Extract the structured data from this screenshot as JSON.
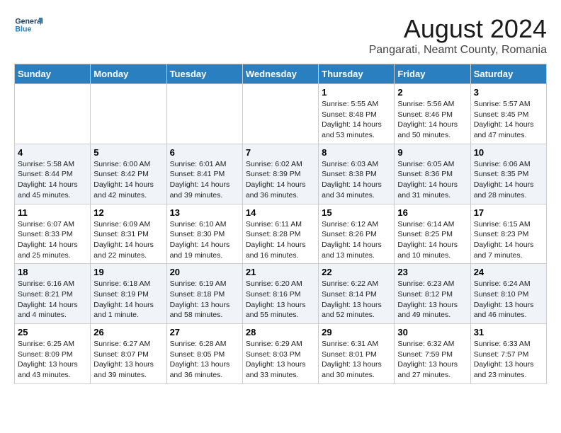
{
  "header": {
    "logo_general": "General",
    "logo_blue": "Blue",
    "month_year": "August 2024",
    "location": "Pangarati, Neamt County, Romania"
  },
  "days_of_week": [
    "Sunday",
    "Monday",
    "Tuesday",
    "Wednesday",
    "Thursday",
    "Friday",
    "Saturday"
  ],
  "weeks": [
    [
      {
        "day": "",
        "info": ""
      },
      {
        "day": "",
        "info": ""
      },
      {
        "day": "",
        "info": ""
      },
      {
        "day": "",
        "info": ""
      },
      {
        "day": "1",
        "info": "Sunrise: 5:55 AM\nSunset: 8:48 PM\nDaylight: 14 hours\nand 53 minutes."
      },
      {
        "day": "2",
        "info": "Sunrise: 5:56 AM\nSunset: 8:46 PM\nDaylight: 14 hours\nand 50 minutes."
      },
      {
        "day": "3",
        "info": "Sunrise: 5:57 AM\nSunset: 8:45 PM\nDaylight: 14 hours\nand 47 minutes."
      }
    ],
    [
      {
        "day": "4",
        "info": "Sunrise: 5:58 AM\nSunset: 8:44 PM\nDaylight: 14 hours\nand 45 minutes."
      },
      {
        "day": "5",
        "info": "Sunrise: 6:00 AM\nSunset: 8:42 PM\nDaylight: 14 hours\nand 42 minutes."
      },
      {
        "day": "6",
        "info": "Sunrise: 6:01 AM\nSunset: 8:41 PM\nDaylight: 14 hours\nand 39 minutes."
      },
      {
        "day": "7",
        "info": "Sunrise: 6:02 AM\nSunset: 8:39 PM\nDaylight: 14 hours\nand 36 minutes."
      },
      {
        "day": "8",
        "info": "Sunrise: 6:03 AM\nSunset: 8:38 PM\nDaylight: 14 hours\nand 34 minutes."
      },
      {
        "day": "9",
        "info": "Sunrise: 6:05 AM\nSunset: 8:36 PM\nDaylight: 14 hours\nand 31 minutes."
      },
      {
        "day": "10",
        "info": "Sunrise: 6:06 AM\nSunset: 8:35 PM\nDaylight: 14 hours\nand 28 minutes."
      }
    ],
    [
      {
        "day": "11",
        "info": "Sunrise: 6:07 AM\nSunset: 8:33 PM\nDaylight: 14 hours\nand 25 minutes."
      },
      {
        "day": "12",
        "info": "Sunrise: 6:09 AM\nSunset: 8:31 PM\nDaylight: 14 hours\nand 22 minutes."
      },
      {
        "day": "13",
        "info": "Sunrise: 6:10 AM\nSunset: 8:30 PM\nDaylight: 14 hours\nand 19 minutes."
      },
      {
        "day": "14",
        "info": "Sunrise: 6:11 AM\nSunset: 8:28 PM\nDaylight: 14 hours\nand 16 minutes."
      },
      {
        "day": "15",
        "info": "Sunrise: 6:12 AM\nSunset: 8:26 PM\nDaylight: 14 hours\nand 13 minutes."
      },
      {
        "day": "16",
        "info": "Sunrise: 6:14 AM\nSunset: 8:25 PM\nDaylight: 14 hours\nand 10 minutes."
      },
      {
        "day": "17",
        "info": "Sunrise: 6:15 AM\nSunset: 8:23 PM\nDaylight: 14 hours\nand 7 minutes."
      }
    ],
    [
      {
        "day": "18",
        "info": "Sunrise: 6:16 AM\nSunset: 8:21 PM\nDaylight: 14 hours\nand 4 minutes."
      },
      {
        "day": "19",
        "info": "Sunrise: 6:18 AM\nSunset: 8:19 PM\nDaylight: 14 hours\nand 1 minute."
      },
      {
        "day": "20",
        "info": "Sunrise: 6:19 AM\nSunset: 8:18 PM\nDaylight: 13 hours\nand 58 minutes."
      },
      {
        "day": "21",
        "info": "Sunrise: 6:20 AM\nSunset: 8:16 PM\nDaylight: 13 hours\nand 55 minutes."
      },
      {
        "day": "22",
        "info": "Sunrise: 6:22 AM\nSunset: 8:14 PM\nDaylight: 13 hours\nand 52 minutes."
      },
      {
        "day": "23",
        "info": "Sunrise: 6:23 AM\nSunset: 8:12 PM\nDaylight: 13 hours\nand 49 minutes."
      },
      {
        "day": "24",
        "info": "Sunrise: 6:24 AM\nSunset: 8:10 PM\nDaylight: 13 hours\nand 46 minutes."
      }
    ],
    [
      {
        "day": "25",
        "info": "Sunrise: 6:25 AM\nSunset: 8:09 PM\nDaylight: 13 hours\nand 43 minutes."
      },
      {
        "day": "26",
        "info": "Sunrise: 6:27 AM\nSunset: 8:07 PM\nDaylight: 13 hours\nand 39 minutes."
      },
      {
        "day": "27",
        "info": "Sunrise: 6:28 AM\nSunset: 8:05 PM\nDaylight: 13 hours\nand 36 minutes."
      },
      {
        "day": "28",
        "info": "Sunrise: 6:29 AM\nSunset: 8:03 PM\nDaylight: 13 hours\nand 33 minutes."
      },
      {
        "day": "29",
        "info": "Sunrise: 6:31 AM\nSunset: 8:01 PM\nDaylight: 13 hours\nand 30 minutes."
      },
      {
        "day": "30",
        "info": "Sunrise: 6:32 AM\nSunset: 7:59 PM\nDaylight: 13 hours\nand 27 minutes."
      },
      {
        "day": "31",
        "info": "Sunrise: 6:33 AM\nSunset: 7:57 PM\nDaylight: 13 hours\nand 23 minutes."
      }
    ]
  ]
}
